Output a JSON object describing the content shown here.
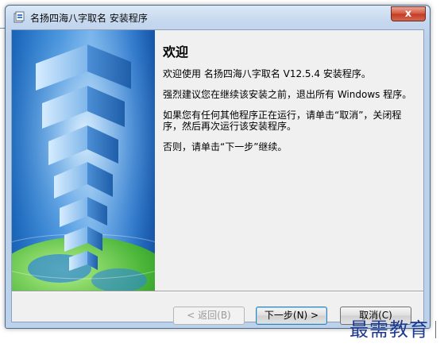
{
  "window": {
    "title": "名扬四海八字取名 安装程序",
    "close_label": "x"
  },
  "content": {
    "heading": "欢迎",
    "paragraphs": [
      "欢迎使用 名扬四海八字取名 V12.5.4 安装程序。",
      "强烈建议您在继续该安装之前，退出所有 Windows 程序。",
      "如果您有任何其他程序正在运行，请单击“取消”，关闭程序，然后再次运行该安装程序。",
      "否则，请单击“下一步”继续。"
    ]
  },
  "buttons": {
    "back": "< 返回(B)",
    "next": "下一步(N) >",
    "cancel": "取消(C)"
  },
  "watermark": "最需教育",
  "colors": {
    "banner_blue": "#2b74c8",
    "globe_green": "#4db83a",
    "watermark": "#1d3a8f"
  }
}
